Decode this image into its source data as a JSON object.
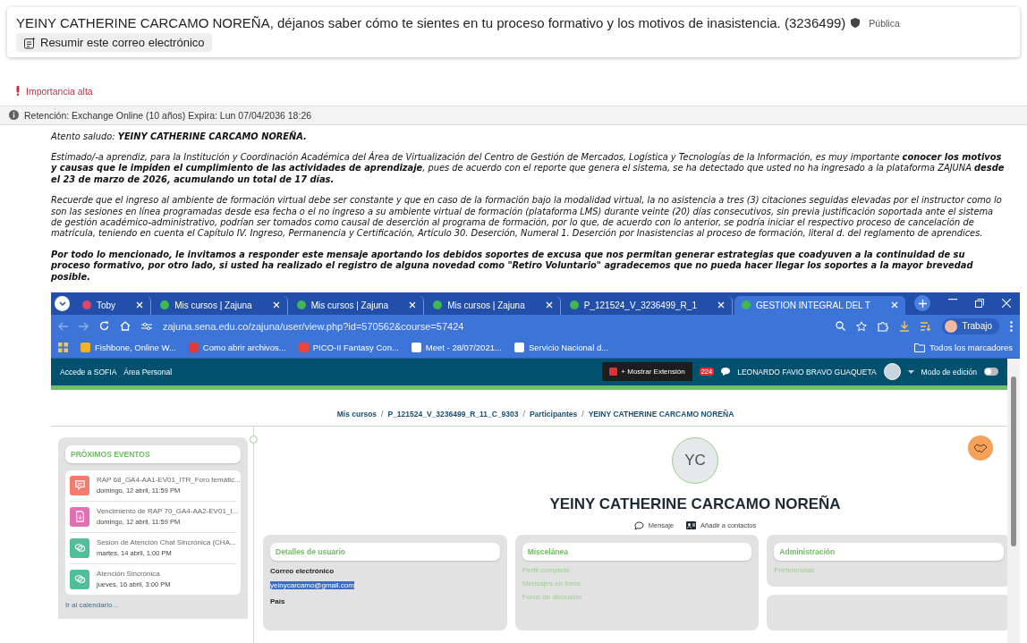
{
  "message": {
    "subject": "YEINY CATHERINE CARCAMO NOREÑA, déjanos saber cómo te sientes en tu proceso formativo y los motivos de inasistencia. (3236499)",
    "sensitivity": "Pública",
    "summarize_button": "Resumir este correo electrónico"
  },
  "importance": "Importancia alta",
  "retention": "Retención: Exchange Online (10 años) Expira: Lun 07/04/2036 18:26",
  "body": [
    {
      "text": "Atento saludo: **YEINY CATHERINE CARCAMO NOREÑA.**",
      "bold": false
    },
    {
      "text": "Estimado/-a aprendiz, para la Institución y Coordinación Académica del Área de Virtualización del Centro de Gestión de Mercados, Logística y Tecnologías de la Información, es muy importante **conocer los motivos y causas que le impiden el cumplimiento de las actividades de aprendizaje**, pues de acuerdo con el reporte que genera el sistema, se ha detectado que usted no ha ingresado a la plataforma ZAJUNA **desde el 23 de marzo de 2026, acumulando un total de 17 días.**",
      "bold": false
    },
    {
      "text": "Recuerde que el ingreso al ambiente de formación virtual debe ser constante y que en caso de la formación bajo la modalidad virtual, la no asistencia a tres (3) citaciones seguidas elevadas por el instructor como lo son las sesiones en línea programadas desde esa fecha o el no ingreso a su ambiente virtual de formación (plataforma LMS) durante veinte (20) días consecutivos, sin previa justificación soportada ante el sistema de gestión académico-administrativo, podrían ser tomados como causal de deserción al programa de formación, por lo que, de acuerdo con lo anterior, se podría iniciar el respectivo proceso de cancelación de matrícula, teniendo en cuenta el Capítulo IV. Ingreso, Permanencia y Certificación, Artículo 30. Deserción, Numeral 1. Deserción por Inasistencias al proceso de formación, literal d. del reglamento de aprendices.",
      "bold": false
    },
    {
      "text": "Por todo lo mencionado, le invitamos a responder este mensaje aportando los debidos soportes de excusa que nos permitan generar estrategias que coadyuven a la continuidad de su proceso formativo, por otro lado, si usted ha realizado el registro de alguna novedad como \"Retiro Voluntario\" agradecemos que no pueda hacer llegar los soportes a la mayor brevedad posible.",
      "bold": true
    }
  ],
  "browser": {
    "tabs": [
      {
        "label": "Toby",
        "color": "#e0466a",
        "selected": false
      },
      {
        "label": "Mis cursos | Zajuna",
        "color": "#3fb950",
        "selected": false
      },
      {
        "label": "Mis cursos | Zajuna",
        "color": "#3fb950",
        "selected": false
      },
      {
        "label": "Mis cursos | Zajuna",
        "color": "#3fb950",
        "selected": false
      },
      {
        "label": "P_121524_V_3236499_R_1",
        "color": "#3fb950",
        "selected": false
      },
      {
        "label": "GESTION INTEGRAL DEL T",
        "color": "#3fb950",
        "selected": true
      }
    ],
    "address": "zajuna.sena.edu.co/zajuna/user/view.php?id=570562&course=57424",
    "profile": "Trabajo",
    "bookmarks": [
      {
        "label": "Fishbone, Online W...",
        "color": "#f0b429"
      },
      {
        "label": "Como abrir archivos...",
        "color": "#e53935"
      },
      {
        "label": "PICO-II Fantasy Con...",
        "color": "#e8453c"
      },
      {
        "label": "Meet - 28/07/2021...",
        "color": "#ffffff"
      },
      {
        "label": "Servicio Nacional d...",
        "color": "#ffffff"
      }
    ],
    "all_bookmarks": "Todos los marcadores"
  },
  "site": {
    "nav_links": [
      "Accede a SOFIA",
      "Área Personal"
    ],
    "extension_button": "+ Mostrar Extensión",
    "notification_count": "224",
    "user_name": "LEONARDO FAVIO BRAVO GUAQUETA",
    "edit_mode": {
      "label": "Modo de edición",
      "on": false
    },
    "breadcrumb_separator": "/",
    "breadcrumb": [
      "Mis cursos",
      "P_121524_V_3236499_R_11_C_9303",
      "Participantes",
      "YEINY CATHERINE CARCAMO NOREÑA"
    ],
    "events_block": {
      "title": "PRÓXIMOS EVENTOS",
      "events": [
        {
          "kind": "forum",
          "color": "#f47c6f",
          "title": "RAP 68_GA4-AA1-EV01_ITR_Foro temátic...",
          "date": "domingo, 12 abril, 11:59 PM"
        },
        {
          "kind": "assignment",
          "color": "#e071b3",
          "title": "Vencimiento de RAP 70_GA4-AA2-EV01_I...",
          "date": "domingo, 12 abril, 11:59 PM"
        },
        {
          "kind": "chat",
          "color": "#4fbf98",
          "title": "Sesion de Atención Chat Sincrónica (CHA...",
          "date": "martes, 14 abril, 1:00 PM"
        },
        {
          "kind": "chat",
          "color": "#4fbf98",
          "title": "Atención Sincrónica",
          "date": "jueves, 16 abril, 3:00 PM"
        }
      ],
      "link": "Ir al calendario..."
    },
    "profile": {
      "initials": "YC",
      "name": "YEINY CATHERINE CARCAMO NOREÑA",
      "actions": [
        {
          "kind": "message",
          "label": "Mensaje"
        },
        {
          "kind": "contact",
          "label": "Añadir a contactos"
        }
      ]
    },
    "cards": [
      {
        "kind": "fields",
        "title": "Detalles de usuario",
        "fields": [
          {
            "label": "Correo electrónico",
            "value": "yeinycarcamo@gmail.com",
            "selected": true
          },
          {
            "label": "País"
          }
        ]
      },
      {
        "kind": "links",
        "title": "Miscelánea",
        "links": [
          "Perfil completo",
          "Mensajes en foros",
          "Foros de discusión"
        ]
      },
      {
        "kind": "links",
        "title": "Administración",
        "links": [
          "Preferencias"
        ]
      }
    ]
  }
}
